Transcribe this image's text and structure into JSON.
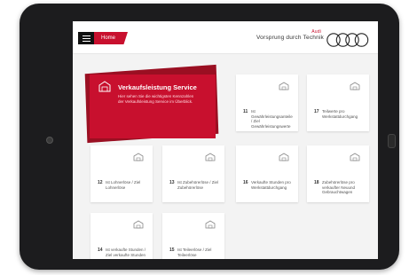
{
  "header": {
    "home_label": "Home",
    "brand_name": "Audi",
    "slogan": "Vorsprung durch Technik"
  },
  "feature": {
    "title": "Verkaufsleistung Service",
    "description": "Hier sehen Sie die wichtigsten Kennzahlen der Verkaufsleistung Service im Überblick."
  },
  "tiles": [
    {
      "num": "11",
      "label": "Ist Gewährleistungsanteile / Ziel Gewährleistungswerte"
    },
    {
      "num": "17",
      "label": "Teilwerte pro Werkstattdurchgang"
    },
    {
      "num": "12",
      "label": "Ist Lohnerlöse / Ziel Lohnerlöse"
    },
    {
      "num": "13",
      "label": "Ist Zubehörerlöse / Ziel Zubehörerlöse"
    },
    {
      "num": "16",
      "label": "Verkaufte Stunden pro Werkstattdurchgang"
    },
    {
      "num": "18",
      "label": "Zubehörerlöse pro verkaufter Neuund Gebrauchtwagen"
    },
    {
      "num": "14",
      "label": "Ist verkaufte Stunden / Ziel verkaufte Stunden"
    },
    {
      "num": "15",
      "label": "Ist Teileerlöse / Ziel Teileerlöse"
    }
  ]
}
